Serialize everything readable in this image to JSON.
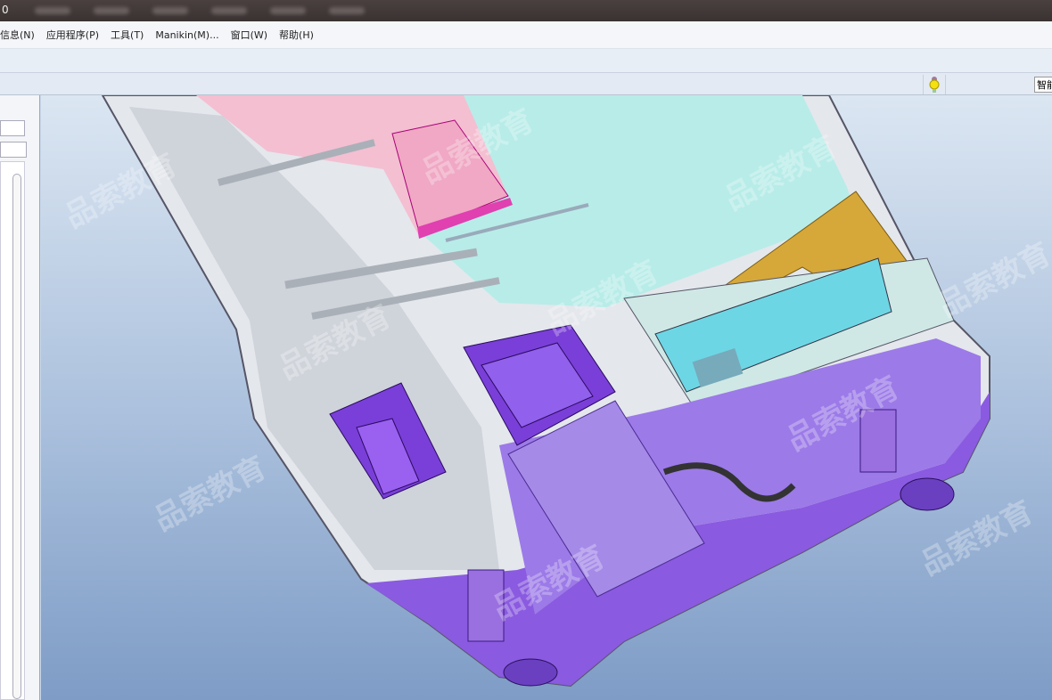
{
  "title_bar": {
    "title_fragment": "0"
  },
  "menu": [
    {
      "label": "信息(N)"
    },
    {
      "label": "应用程序(P)"
    },
    {
      "label": "工具(T)"
    },
    {
      "label": "Manikin(M)..."
    },
    {
      "label": "窗口(W)"
    },
    {
      "label": "帮助(H)"
    }
  ],
  "toolbar": {
    "bulb_icon": "light-bulb-icon",
    "smart_label": "智能"
  },
  "left_panel": {
    "icon": "list-view-icon"
  },
  "watermark": "品索教育",
  "colors": {
    "pink": "#f0b8cc",
    "purple": "#8a5ae0",
    "cyan": "#6dd6e4",
    "gold": "#e0a830",
    "grey": "#d7dbe2"
  }
}
